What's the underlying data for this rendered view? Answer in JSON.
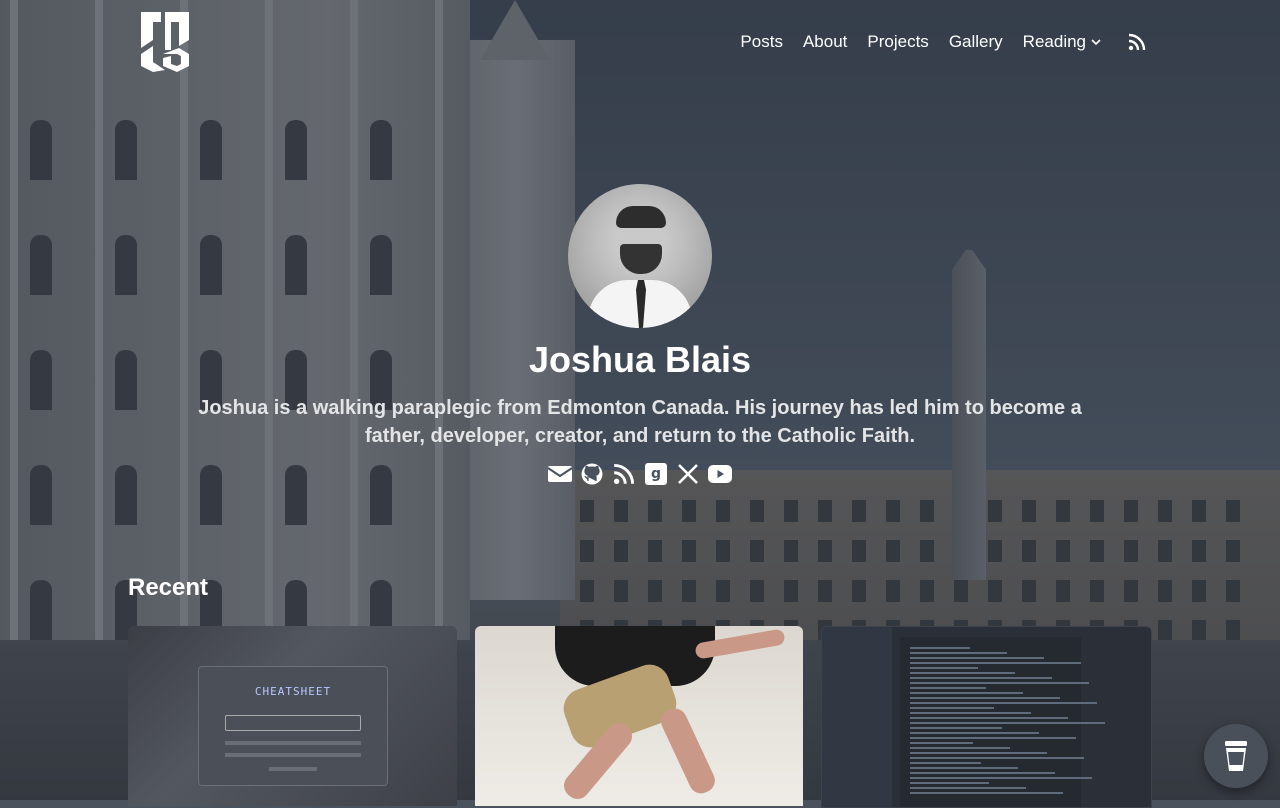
{
  "header": {
    "logo": "JB",
    "nav": [
      {
        "label": "Posts"
      },
      {
        "label": "About"
      },
      {
        "label": "Projects"
      },
      {
        "label": "Gallery"
      },
      {
        "label": "Reading"
      }
    ],
    "rss_icon": "rss-icon"
  },
  "hero": {
    "name": "Joshua Blais",
    "bio": "Joshua is a walking paraplegic from Edmonton Canada. His journey has led him to become a father, developer, creator, and return to the Catholic Faith.",
    "socials": [
      "email-icon",
      "github-icon",
      "rss-icon",
      "goodreads-icon",
      "x-icon",
      "youtube-icon"
    ]
  },
  "recent": {
    "title": "Recent",
    "cards": [
      {
        "image": "cheatsheet-screenshot",
        "text": "CHEATSHEET"
      },
      {
        "image": "person-on-bed-photo"
      },
      {
        "image": "code-editor-screenshot"
      }
    ]
  },
  "floating": {
    "icon": "coffee-cup-icon"
  },
  "colors": {
    "text": "#ffffff",
    "bio": "#e3e4e6",
    "overlay": "#3f4753"
  }
}
